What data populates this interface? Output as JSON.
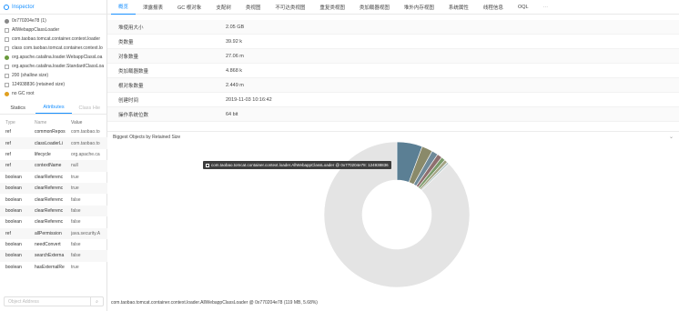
{
  "inspector": {
    "title": "Inspector",
    "objects": [
      {
        "icon": "object-icon",
        "label": "0x770204e78 (1)",
        "color": "#888"
      },
      {
        "icon": "class-icon",
        "label": "AllWebappClassLoader",
        "color": "#aaa"
      },
      {
        "icon": "class-icon",
        "label": "com.taobao.tomcat.container.context.loader",
        "color": "#aaa"
      },
      {
        "icon": "class-icon",
        "label": "class com.taobao.tomcat.container.context.lo",
        "color": "#aaa"
      },
      {
        "icon": "classloader-icon",
        "label": "org.apache.catalina.loader.WebappClassLoa",
        "color": "#6a9a3c"
      },
      {
        "icon": "class-icon",
        "label": "org.apache.catalina.loader.StandardClassLoa",
        "color": "#aaa"
      },
      {
        "icon": "size-icon",
        "label": "200 (shallow size)",
        "color": "#aaa"
      },
      {
        "icon": "size-icon",
        "label": "124938836 (retained size)",
        "color": "#aaa"
      },
      {
        "icon": "gc-root-icon",
        "label": "no GC root",
        "color": "#e0a020"
      }
    ],
    "subtabs": [
      "Statics",
      "Attributes",
      "Class Hie"
    ],
    "active_subtab": "Attributes",
    "columns": [
      "Type",
      "Name",
      "Value"
    ],
    "rows": [
      {
        "type": "ref",
        "name": "commonRepos",
        "value": "com.taobao.to"
      },
      {
        "type": "ref",
        "name": "classLoaderLi",
        "value": "com.taobao.to"
      },
      {
        "type": "ref",
        "name": "lifecycle",
        "value": "org.apache.ca"
      },
      {
        "type": "ref",
        "name": "contextName",
        "value": "null"
      },
      {
        "type": "boolean",
        "name": "clearReferenc",
        "value": "true"
      },
      {
        "type": "boolean",
        "name": "clearReferenc",
        "value": "true"
      },
      {
        "type": "boolean",
        "name": "clearReferenc",
        "value": "false"
      },
      {
        "type": "boolean",
        "name": "clearReferenc",
        "value": "false"
      },
      {
        "type": "boolean",
        "name": "clearReferenc",
        "value": "false"
      },
      {
        "type": "ref",
        "name": "allPermission",
        "value": "java.security.A"
      },
      {
        "type": "boolean",
        "name": "needConvert",
        "value": "false"
      },
      {
        "type": "boolean",
        "name": "searchExterna",
        "value": "false"
      },
      {
        "type": "boolean",
        "name": "hasExternalRe",
        "value": "true"
      }
    ],
    "filter_placeholder": "Object Address"
  },
  "tabs": [
    "概览",
    "泄露报表",
    "GC 根对象",
    "支配树",
    "类视图",
    "不可达类视图",
    "重复类视图",
    "类加载器视图",
    "堆外内存视图",
    "系统属性",
    "线程信息",
    "OQL",
    "···"
  ],
  "active_tab": "概览",
  "info": [
    {
      "k": "堆使用大小",
      "v": "2.05 GB"
    },
    {
      "k": "类数量",
      "v": "39.92 k"
    },
    {
      "k": "对象数量",
      "v": "27.06 m"
    },
    {
      "k": "类加载器数量",
      "v": "4.868 k"
    },
    {
      "k": "根对象数量",
      "v": "2.449 m"
    },
    {
      "k": "创建时间",
      "v": "2019-11-03 10:16:42"
    },
    {
      "k": "操作系统位数",
      "v": "64 bit"
    }
  ],
  "chart_header": "Biggest Objects by Retained Size",
  "tooltip": "com.taobao.tomcat.container.context.loader.AllWebappClassLoader @ 0x770204e78: 124938836",
  "footer": "com.taobao.tomcat.container.context.loader.AllWebappClassLoader @ 0x770204e78 (119 MB, 5.68%)",
  "chart_data": {
    "type": "pie",
    "donut": true,
    "slices": [
      {
        "value": 5.68,
        "color": "#5b7f94"
      },
      {
        "value": 2.4,
        "color": "#8a8a6a"
      },
      {
        "value": 1.4,
        "color": "#6f8a99"
      },
      {
        "value": 1.1,
        "color": "#8e6f6f"
      },
      {
        "value": 0.9,
        "color": "#7a9a6a"
      },
      {
        "value": 0.7,
        "color": "#a0a080"
      },
      {
        "value": 0.5,
        "color": "#b9c9c9"
      },
      {
        "value": 87.32,
        "color": "#e4e4e4"
      }
    ]
  }
}
